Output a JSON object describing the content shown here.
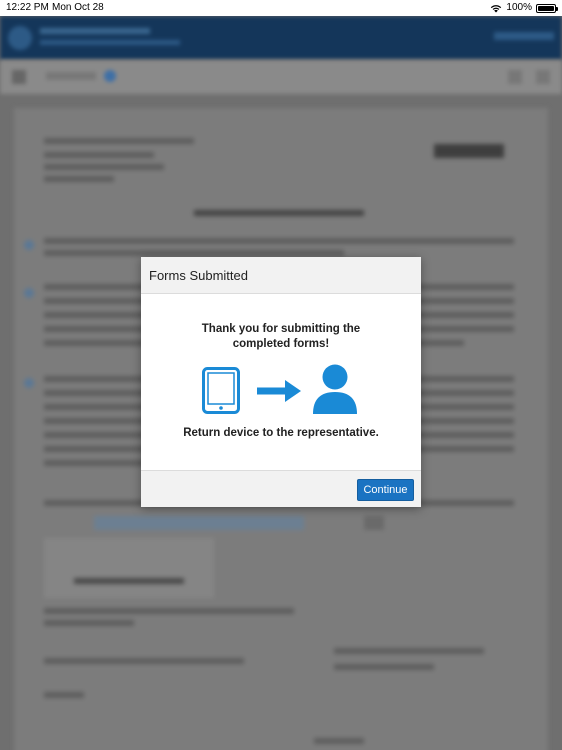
{
  "status_bar": {
    "time": "12:22 PM",
    "date": "Mon Oct 28",
    "battery_text": "100%",
    "battery_level": 1.0,
    "wifi_icon": "wifi-icon",
    "battery_icon": "battery-icon"
  },
  "dialog": {
    "title": "Forms Submitted",
    "message_line1": "Thank you for submitting the",
    "message_line2": "completed forms!",
    "instruction": "Return device to the representative.",
    "continue_label": "Continue",
    "icons": [
      "tablet-icon",
      "arrow-right-icon",
      "person-icon"
    ]
  },
  "colors": {
    "accent": "#1a8ad6",
    "button": "#1a73c2",
    "header_bar": "#14365a"
  }
}
